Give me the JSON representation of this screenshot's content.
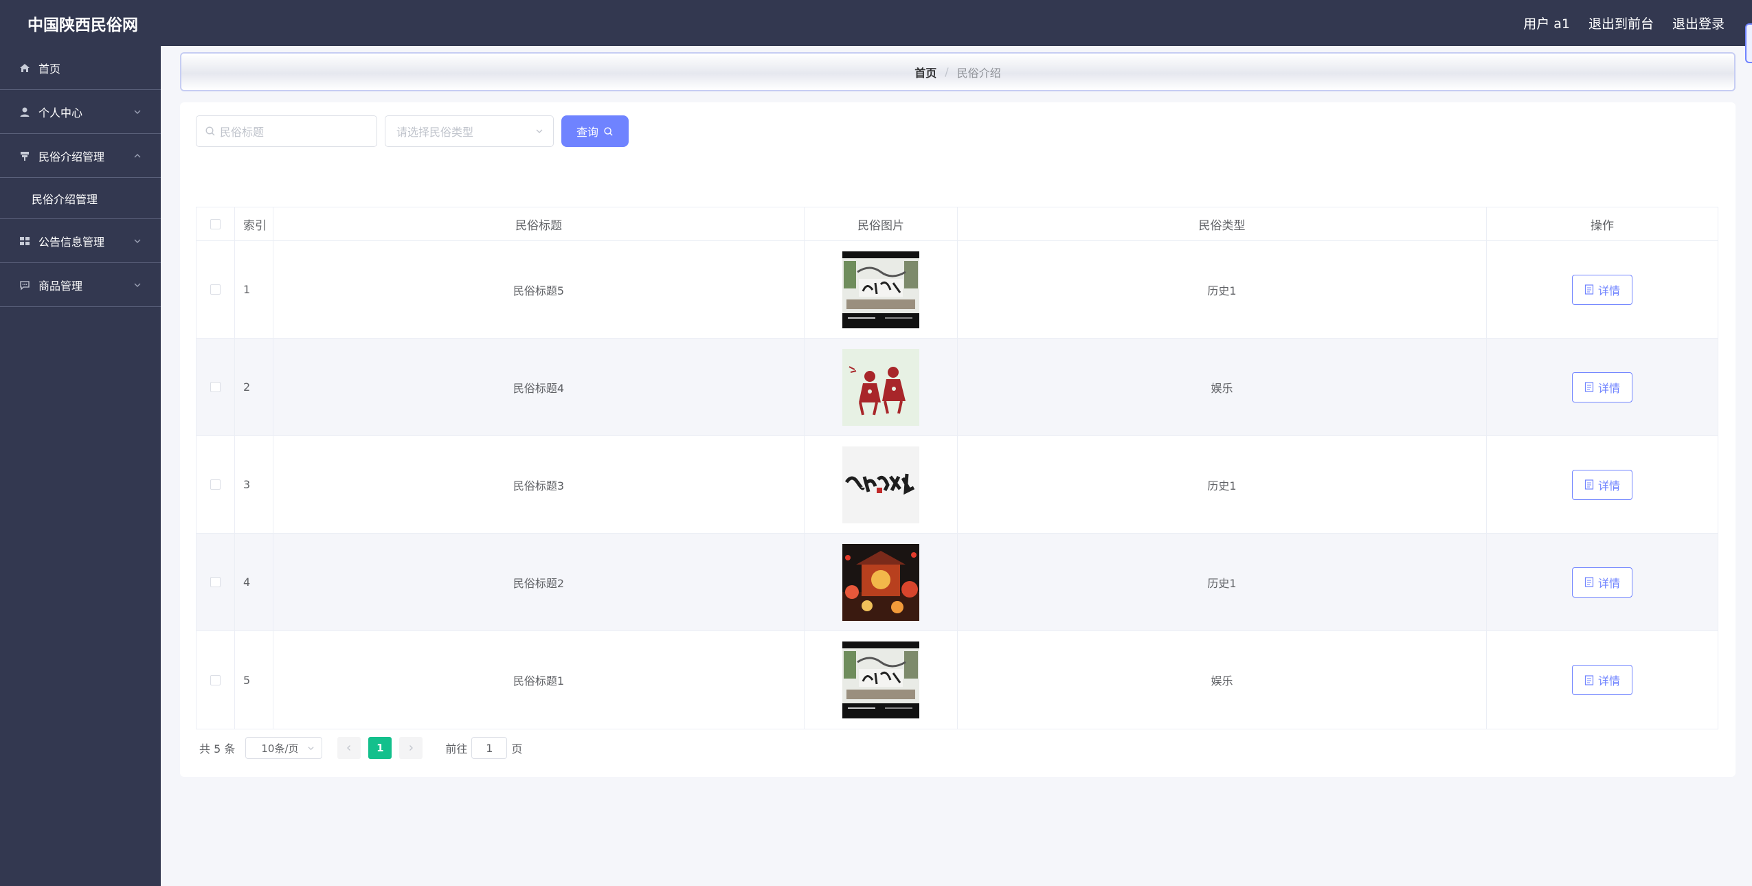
{
  "header": {
    "brand": "中国陕西民俗网",
    "user_label": "用户 a1",
    "front_label": "退出到前台",
    "logout_label": "退出登录"
  },
  "sidebar": {
    "items": [
      {
        "label": "首页",
        "icon": "home-icon"
      },
      {
        "label": "个人中心",
        "icon": "user-icon"
      },
      {
        "label": "民俗介绍管理",
        "icon": "folk-icon",
        "expanded": true
      },
      {
        "label": "公告信息管理",
        "icon": "grid-icon"
      },
      {
        "label": "商品管理",
        "icon": "message-icon"
      }
    ],
    "sub_item": "民俗介绍管理"
  },
  "breadcrumb": {
    "home": "首页",
    "current": "民俗介绍"
  },
  "search": {
    "title_placeholder": "民俗标题",
    "type_placeholder": "请选择民俗类型",
    "query_label": "查询"
  },
  "table": {
    "headers": [
      "索引",
      "民俗标题",
      "民俗图片",
      "民俗类型",
      "操作"
    ],
    "detail_label": "详情",
    "rows": [
      {
        "index": "1",
        "title": "民俗标题5",
        "type": "历史1",
        "image": "folk-culture-banner"
      },
      {
        "index": "2",
        "title": "民俗标题4",
        "type": "娱乐",
        "image": "paper-cut-figures"
      },
      {
        "index": "3",
        "title": "民俗标题3",
        "type": "历史1",
        "image": "folk-calligraphy"
      },
      {
        "index": "4",
        "title": "民俗标题2",
        "type": "历史1",
        "image": "lantern-festival"
      },
      {
        "index": "5",
        "title": "民俗标题1",
        "type": "娱乐",
        "image": "folk-culture-banner"
      }
    ]
  },
  "pagination": {
    "total": "共 5 条",
    "page_size": "10条/页",
    "current_page": "1",
    "goto_prefix": "前往",
    "goto_value": "1",
    "goto_suffix": "页"
  },
  "colors": {
    "sidebar_bg": "#333850",
    "accent": "#6f83ff",
    "page_active": "#13c08c"
  }
}
